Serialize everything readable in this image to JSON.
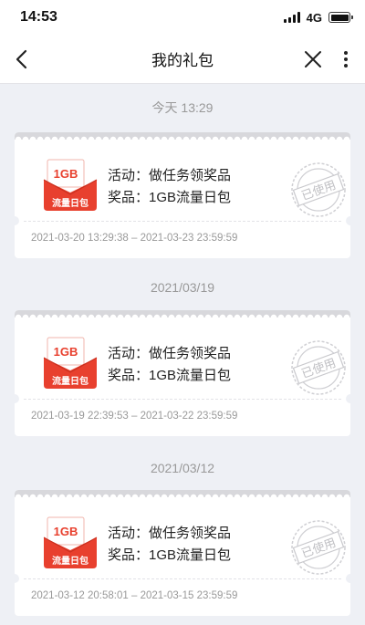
{
  "status_bar": {
    "time": "14:53",
    "network": "4G"
  },
  "nav": {
    "title": "我的礼包"
  },
  "gifts": [
    {
      "date_header": "今天 13:29",
      "icon_size": "1GB",
      "icon_caption": "流量日包",
      "activity_label": "活动：",
      "activity": "做任务领奖品",
      "prize_label": "奖品：",
      "prize": "1GB流量日包",
      "stamp": "已使用",
      "validity": "2021-03-20 13:29:38 – 2021-03-23 23:59:59"
    },
    {
      "date_header": "2021/03/19",
      "icon_size": "1GB",
      "icon_caption": "流量日包",
      "activity_label": "活动：",
      "activity": "做任务领奖品",
      "prize_label": "奖品：",
      "prize": "1GB流量日包",
      "stamp": "已使用",
      "validity": "2021-03-19 22:39:53 – 2021-03-22 23:59:59"
    },
    {
      "date_header": "2021/03/12",
      "icon_size": "1GB",
      "icon_caption": "流量日包",
      "activity_label": "活动：",
      "activity": "做任务领奖品",
      "prize_label": "奖品：",
      "prize": "1GB流量日包",
      "stamp": "已使用",
      "validity": "2021-03-12 20:58:01 – 2021-03-15 23:59:59"
    }
  ],
  "colors": {
    "accent_red": "#e8402e",
    "stamp_gray": "#c9c9cd",
    "muted_text": "#999999"
  }
}
